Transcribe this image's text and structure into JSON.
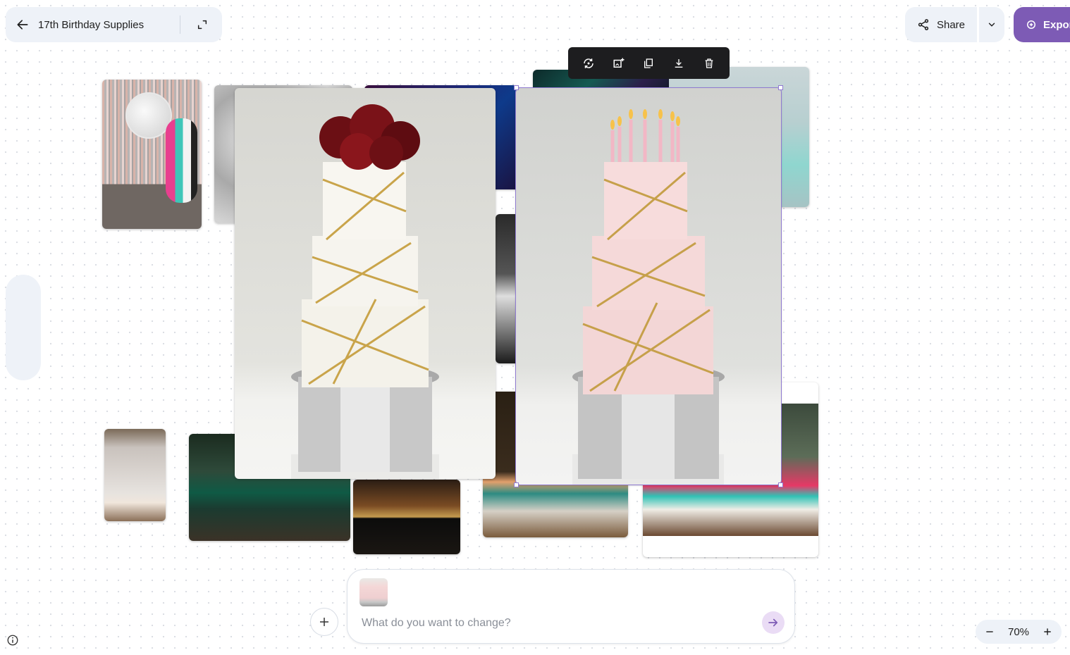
{
  "header": {
    "project_title": "17th Birthday Supplies",
    "share_label": "Share",
    "export_label": "Export"
  },
  "prompt": {
    "placeholder": "What do you want to change?"
  },
  "zoom": {
    "level": "70%"
  },
  "colors": {
    "accent": "#7d5bb5",
    "panel": "#eef2f8",
    "toolbar": "#1d1d1f",
    "selection": "#8f7ad1"
  }
}
